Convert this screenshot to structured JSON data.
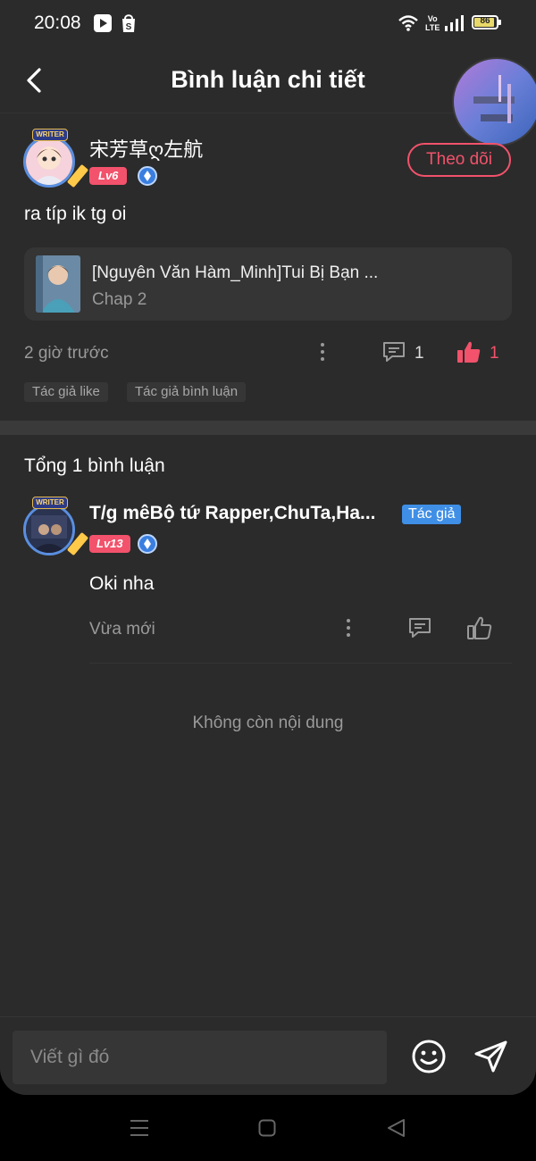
{
  "status_bar": {
    "time": "20:08",
    "battery": "86",
    "network_top": "Vo",
    "network_bottom": "LTE",
    "icons": [
      "play-store-icon",
      "shopee-icon",
      "wifi-icon",
      "volte-icon",
      "signal-icon",
      "battery-icon"
    ]
  },
  "header": {
    "title": "Bình luận chi tiết",
    "back_icon": "chevron-left-icon"
  },
  "post": {
    "user": {
      "name": "宋芳草ღ左航",
      "level": "Lv6",
      "avatar_badge": "WRITER"
    },
    "follow_label": "Theo dõi",
    "text": "ra típ ik tg oi",
    "story": {
      "title": "[Nguyên Văn Hàm_Minh]Tui Bị Bạn ...",
      "chapter": "Chap 2"
    },
    "time": "2 giờ trước",
    "reply_count": "1",
    "like_count": "1",
    "tags": [
      "Tác giả like",
      "Tác giả bình luận"
    ]
  },
  "replies_section": {
    "total_label": "Tổng 1 bình luận",
    "items": [
      {
        "name": "T/g mêBộ tứ Rapper,ChuTa,Ha...",
        "author_tag": "Tác giả",
        "level": "Lv13",
        "avatar_badge": "WRITER",
        "text": "Oki nha",
        "time": "Vừa mới"
      }
    ],
    "end_note": "Không còn nội dung"
  },
  "input_bar": {
    "placeholder": "Viết gì đó",
    "emoji_icon": "smiley-icon",
    "send_icon": "send-icon"
  },
  "colors": {
    "background": "#2b2b2b",
    "accent": "#f2526b",
    "author_tag": "#3f8fe6",
    "muted_text": "#9a9a9a"
  }
}
